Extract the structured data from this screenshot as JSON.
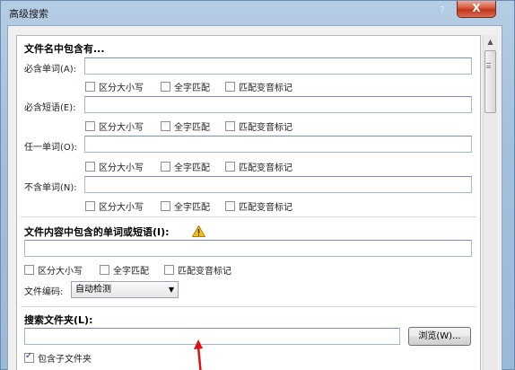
{
  "window": {
    "title": "高级搜索",
    "close_label": "X"
  },
  "filename_section": {
    "heading": "文件名中包含有...",
    "rows": [
      {
        "label": "必含单词(A):",
        "value": ""
      },
      {
        "label": "必含短语(E):",
        "value": ""
      },
      {
        "label": "任一单词(O):",
        "value": ""
      },
      {
        "label": "不含单词(N):",
        "value": ""
      }
    ],
    "options": [
      "区分大小写",
      "全字匹配",
      "匹配变音标记"
    ]
  },
  "content_section": {
    "heading": "文件内容中包含的单词或短语(I):",
    "value": "",
    "options": [
      "区分大小写",
      "全字匹配",
      "匹配变音标记"
    ],
    "encoding_label": "文件编码:",
    "encoding_value": "自动检测"
  },
  "folder_section": {
    "heading": "搜索文件夹(L):",
    "value": "",
    "browse_label": "浏览(W)...",
    "include_subfolders_label": "包含子文件夹",
    "include_subfolders_checked": true
  },
  "colors": {
    "arrow": "#e01010",
    "warning": "#f2c21b"
  },
  "icons": {
    "warning": "warning-triangle-icon",
    "scroll_up": "scroll-up-arrow-icon",
    "dropdown": "dropdown-arrow-icon"
  }
}
